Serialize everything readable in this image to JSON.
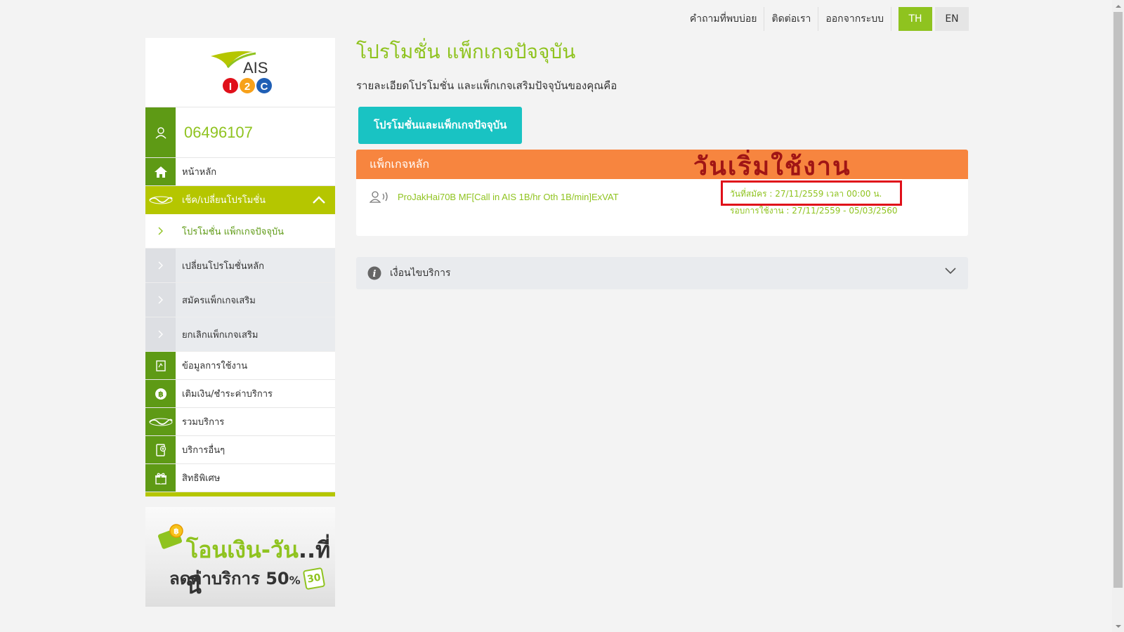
{
  "topnav": {
    "faq": "คำถามที่พบบ่อย",
    "contact": "ติดต่อเรา",
    "logout": "ออกจากระบบ",
    "lang_th": "TH",
    "lang_en": "EN"
  },
  "logo": {
    "brand": "AIS",
    "sub": [
      "I",
      "2",
      "C"
    ]
  },
  "sidebar": {
    "phone": "06496107",
    "menu": [
      {
        "label": "หน้าหลัก",
        "icon": "home-icon"
      },
      {
        "label": "เช็ค/เปลี่ยนโปรโมชั่น",
        "icon": "promotion-icon"
      }
    ],
    "submenu": [
      {
        "label": "โปรโมชั่น แพ็กเกจปัจจุบัน"
      },
      {
        "label": "เปลี่ยนโปรโมชั่นหลัก"
      },
      {
        "label": "สมัครแพ็กเกจเสริม"
      },
      {
        "label": "ยกเลิกแพ็กเกจเสริม"
      }
    ],
    "menu2": [
      {
        "label": "ข้อมูลการใช้งาน",
        "icon": "usage-icon"
      },
      {
        "label": "เติมเงิน/ชำระค่าบริการ",
        "icon": "baht-icon"
      },
      {
        "label": "รวมบริการ",
        "icon": "services-icon"
      },
      {
        "label": "บริการอื่นๆ",
        "icon": "other-services-icon"
      },
      {
        "label": "สิทธิพิเศษ",
        "icon": "gift-icon"
      }
    ]
  },
  "banner": {
    "line1": "โอนเงิน-วัน",
    "line1_dark": "..ที่นี่",
    "line2": "ลดค่าบริการ 50",
    "line2_suffix": "%",
    "badge": "30"
  },
  "main": {
    "title": "โปรโมชั่น แพ็กเกจปัจจุบัน",
    "subtitle": "รายละเอียดโปรโมชั่น และแพ็กเกจเสริมปัจจุบันของคุณคือ",
    "tab": "โปรโมชั่นและแพ็กเกจปัจจุบัน",
    "package": {
      "header": "แพ็กเกจหลัก",
      "annotation": "วันเริ่มใช้งาน",
      "name": "ProJakHai70B MF[Call in AIS 1B/hr Oth 1B/min]ExVAT",
      "register_date": "วันที่สมัคร : 27/11/2559 เวลา 00:00 น.",
      "cycle": "รอบการใช้งาน : 27/11/2559 - 05/03/2560"
    },
    "terms": "เงื่อนไขบริการ"
  },
  "colors": {
    "green": "#8fc31f",
    "dark_green": "#5e9a15",
    "lime": "#b5c600",
    "teal": "#19c3c3",
    "orange": "#f7853f",
    "annotation_red": "#e0101a"
  }
}
